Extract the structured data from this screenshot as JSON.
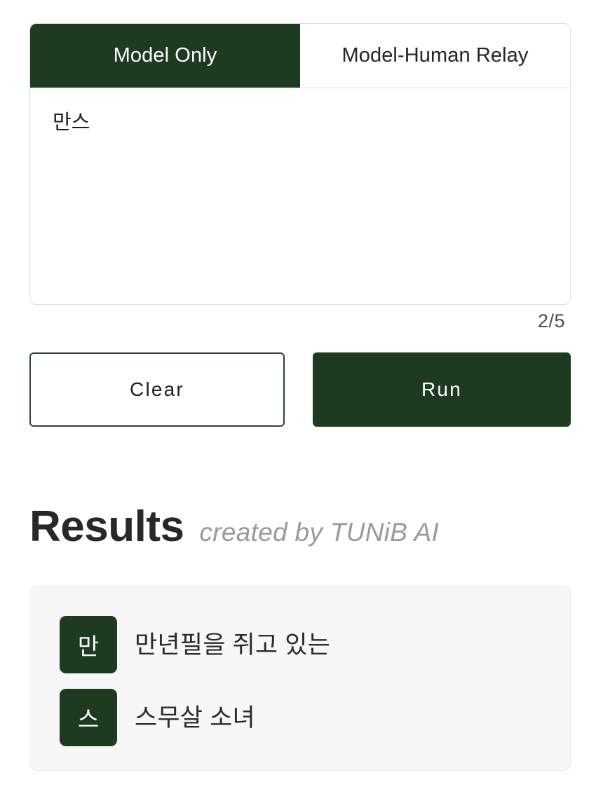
{
  "tabs": [
    {
      "label": "Model Only",
      "active": true
    },
    {
      "label": "Model-Human Relay",
      "active": false
    }
  ],
  "input": {
    "value": "만스",
    "placeholder": "",
    "counter": "2/5"
  },
  "actions": {
    "clear_label": "Clear",
    "run_label": "Run"
  },
  "results": {
    "title": "Results",
    "subtitle": "created by TUNiB AI",
    "rows": [
      {
        "badge": "만",
        "text": "만년필을 쥐고 있는"
      },
      {
        "badge": "스",
        "text": "스무살 소녀"
      }
    ]
  },
  "colors": {
    "accent_green": "#1e3a21",
    "page_bg": "#ffffff",
    "card_bg": "#f7f7f7",
    "muted_text": "#9a9a9a"
  }
}
